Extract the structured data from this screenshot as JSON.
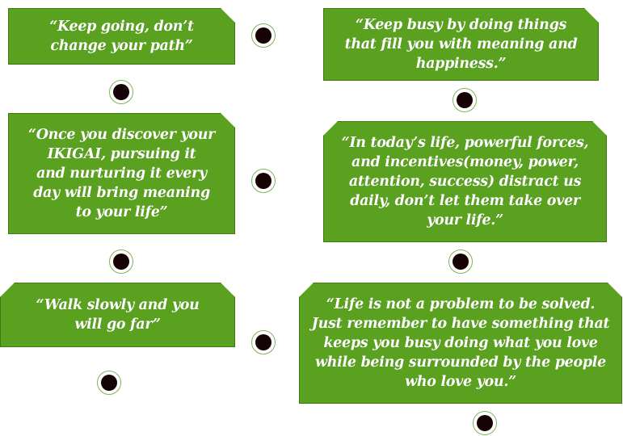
{
  "quotes": [
    "“Keep going, don’t\nchange your path”",
    "“Keep busy by doing things\nthat fill you with meaning and\nhappiness.”",
    "“Once you discover your\nIKIGAI, pursuing it\nand nurturing it every\nday will bring meaning\nto your life”",
    "“In today’s life, powerful forces,\nand incentives(money, power,\nattention, success) distract us\ndaily, don’t let them take over\nyour life.”",
    "“Walk slowly and you\nwill go far”",
    "“Life is not a problem to be solved.\nJust remember to have something that\nkeeps you busy doing what you love\nwhile being surrounded by the people\nwho love you.”"
  ],
  "colors": {
    "card_fill": "#59a11f",
    "card_text": "#ffffff",
    "bullet": "#160306"
  }
}
